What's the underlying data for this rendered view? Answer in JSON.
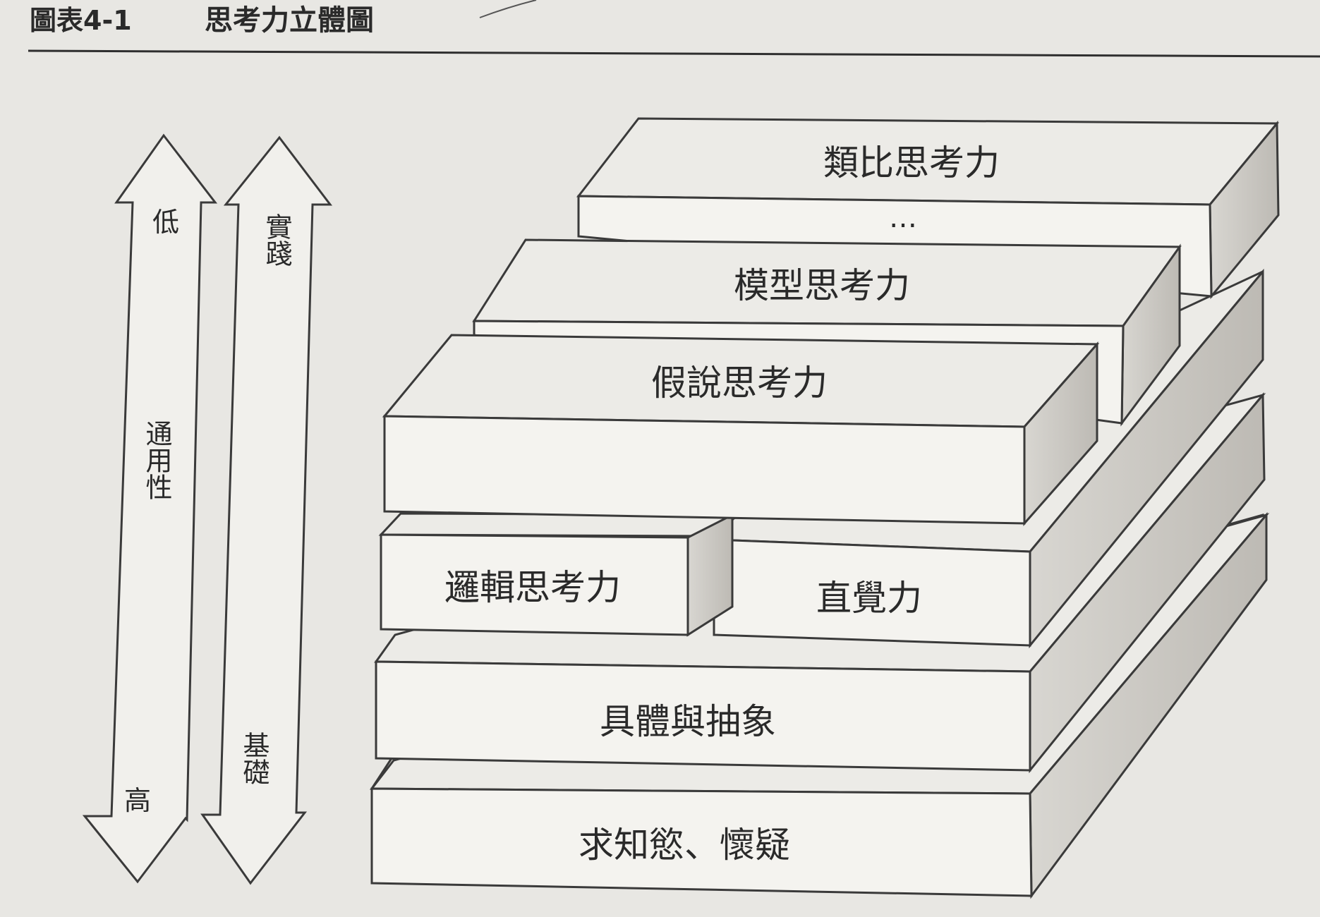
{
  "figure": {
    "number": "圖表4-1",
    "title": "思考力立體圖"
  },
  "left_arrows": {
    "generality": {
      "top": "低",
      "middle": "通用性",
      "bottom": "高"
    },
    "practice": {
      "top": "實踐",
      "bottom": "基礎"
    }
  },
  "layers": {
    "analogy": "類比思考力",
    "ellipsis": "…",
    "model": "模型思考力",
    "hypothesis": "假說思考力",
    "logical": "邏輯思考力",
    "intuition": "直覺力",
    "concrete_abstract": "具體與抽象",
    "curiosity": "求知慾、懷疑"
  },
  "colors": {
    "background": "#e8e7e3",
    "box_front": "#f4f3ef",
    "box_top": "#ecebe7",
    "box_side": "#cfcdc8",
    "stroke": "#3a3a3a"
  }
}
